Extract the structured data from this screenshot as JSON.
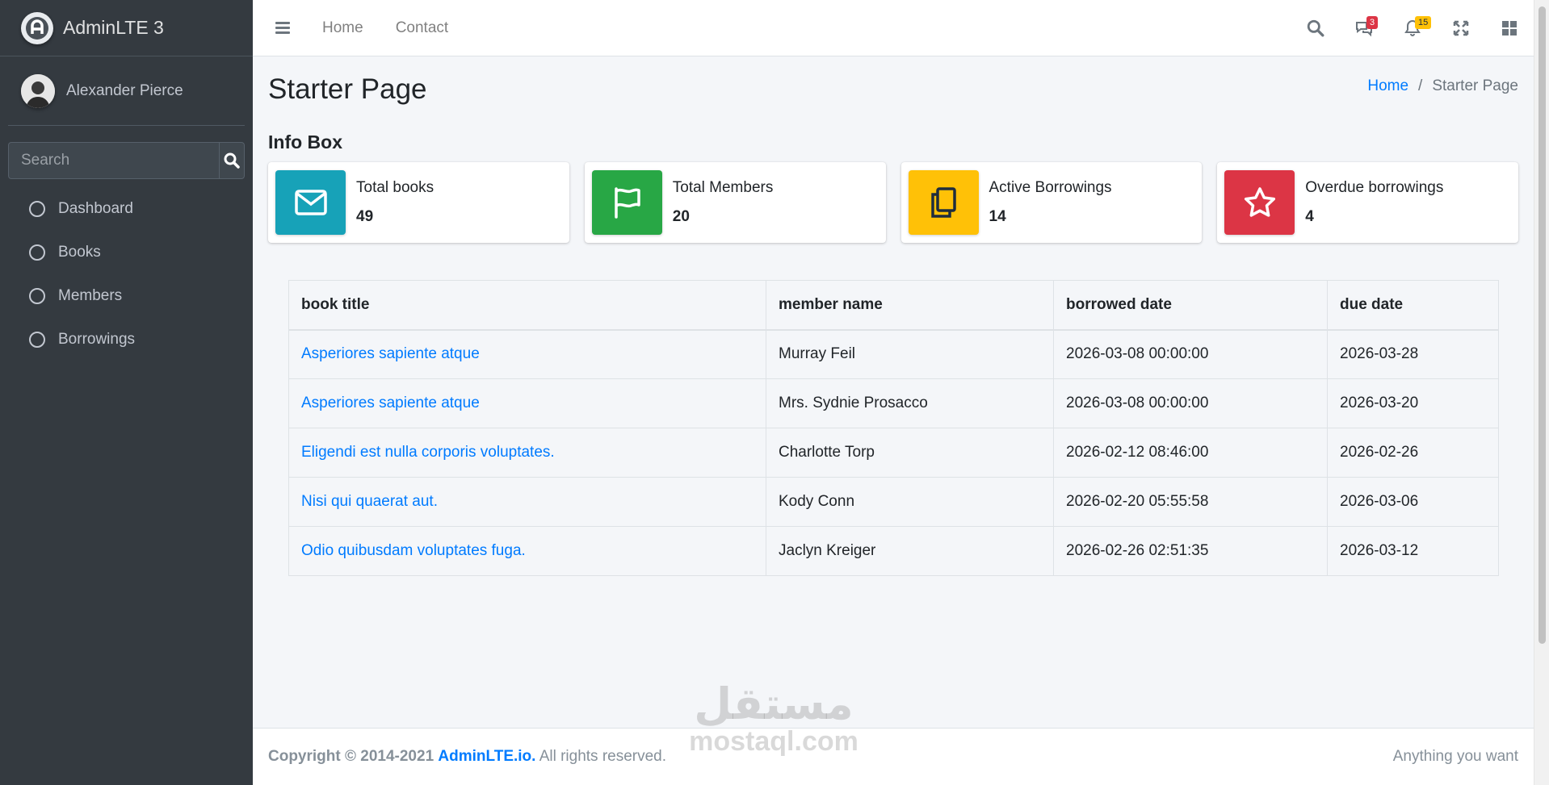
{
  "sidebar": {
    "brand": "AdminLTE 3",
    "user_name": "Alexander Pierce",
    "search_placeholder": "Search",
    "items": [
      {
        "label": "Dashboard"
      },
      {
        "label": "Books"
      },
      {
        "label": "Members"
      },
      {
        "label": "Borrowings"
      }
    ]
  },
  "navbar": {
    "links": [
      "Home",
      "Contact"
    ],
    "messages_badge": "3",
    "notifications_badge": "15"
  },
  "page": {
    "title": "Starter Page",
    "breadcrumb": [
      "Home",
      "Starter Page"
    ],
    "section_title": "Info Box"
  },
  "info_boxes": [
    {
      "label": "Total books",
      "value": "49",
      "color": "#17a2b8",
      "icon": "envelope-icon"
    },
    {
      "label": "Total Members",
      "value": "20",
      "color": "#28a745",
      "icon": "flag-icon"
    },
    {
      "label": "Active Borrowings",
      "value": "14",
      "color": "#ffc107",
      "icon": "copy-icon"
    },
    {
      "label": "Overdue borrowings",
      "value": "4",
      "color": "#dc3545",
      "icon": "star-icon"
    }
  ],
  "table": {
    "headers": [
      "book title",
      "member name",
      "borrowed date",
      "due date"
    ],
    "rows": [
      [
        "Asperiores sapiente atque",
        "Murray Feil",
        "2026-03-08 00:00:00",
        "2026-03-28"
      ],
      [
        "Asperiores sapiente atque",
        "Mrs. Sydnie Prosacco",
        "2026-03-08 00:00:00",
        "2026-03-20"
      ],
      [
        "Eligendi est nulla corporis voluptates.",
        "Charlotte Torp",
        "2026-02-12 08:46:00",
        "2026-02-26"
      ],
      [
        "Nisi qui quaerat aut.",
        "Kody Conn",
        "2026-02-20 05:55:58",
        "2026-03-06"
      ],
      [
        "Odio quibusdam voluptates fuga.",
        "Jaclyn Kreiger",
        "2026-02-26 02:51:35",
        "2026-03-12"
      ]
    ]
  },
  "footer": {
    "copyright": "Copyright © 2014-2021",
    "link": "AdminLTE.io.",
    "rights": "All rights reserved.",
    "right_text": "Anything you want"
  },
  "watermark": {
    "arabic": "مستقل",
    "latin": "mostaql.com"
  }
}
